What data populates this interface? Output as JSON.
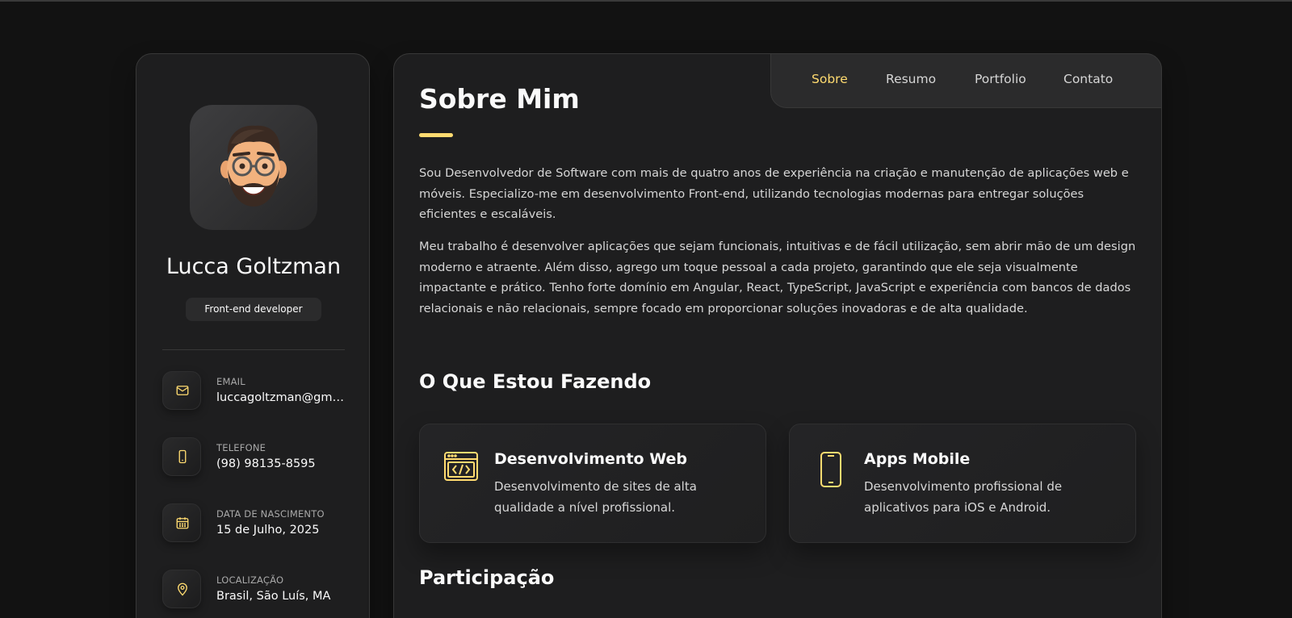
{
  "nav": {
    "items": [
      {
        "label": "Sobre",
        "active": true
      },
      {
        "label": "Resumo",
        "active": false
      },
      {
        "label": "Portfolio",
        "active": false
      },
      {
        "label": "Contato",
        "active": false
      }
    ]
  },
  "sidebar": {
    "avatar_icon": "memoji-avatar",
    "name": "Lucca Goltzman",
    "role": "Front-end developer",
    "contacts": [
      {
        "icon": "mail-icon",
        "title": "EMAIL",
        "value": "luccagoltzman@gmail.com"
      },
      {
        "icon": "phone-icon",
        "title": "TELEFONE",
        "value": "(98) 98135-8595"
      },
      {
        "icon": "calendar-icon",
        "title": "DATA DE NASCIMENTO",
        "value": "15 de Julho, 2025"
      },
      {
        "icon": "location-icon",
        "title": "LOCALIZAÇÃO",
        "value": "Brasil, São Luís, MA"
      }
    ]
  },
  "main": {
    "title": "Sobre Mim",
    "paragraphs": [
      "Sou Desenvolvedor de Software com mais de quatro anos de experiência na criação e manutenção de aplicações web e móveis. Especializo-me em desenvolvimento Front-end, utilizando tecnologias modernas para entregar soluções eficientes e escaláveis.",
      "Meu trabalho é desenvolver aplicações que sejam funcionais, intuitivas e de fácil utilização, sem abrir mão de um design moderno e atraente. Além disso, agrego um toque pessoal a cada projeto, garantindo que ele seja visualmente impactante e prático. Tenho forte domínio em Angular, React, TypeScript, JavaScript e experiência com bancos de dados relacionais e não relacionais, sempre focado em proporcionar soluções inovadoras e de alta qualidade."
    ],
    "services_title": "O Que Estou Fazendo",
    "services": [
      {
        "icon": "code-window-icon",
        "title": "Desenvolvimento Web",
        "text": "Desenvolvimento de sites de alta qualidade a nível profissional."
      },
      {
        "icon": "smartphone-icon",
        "title": "Apps Mobile",
        "text": "Desenvolvimento profissional de aplicativos para iOS e Android."
      }
    ],
    "participation_title": "Participação"
  },
  "colors": {
    "background": "#121212",
    "panel": "#1e1e1f",
    "accent": "#ffdb70",
    "text": "#fafafa",
    "muted_text": "#d6d6d6"
  }
}
